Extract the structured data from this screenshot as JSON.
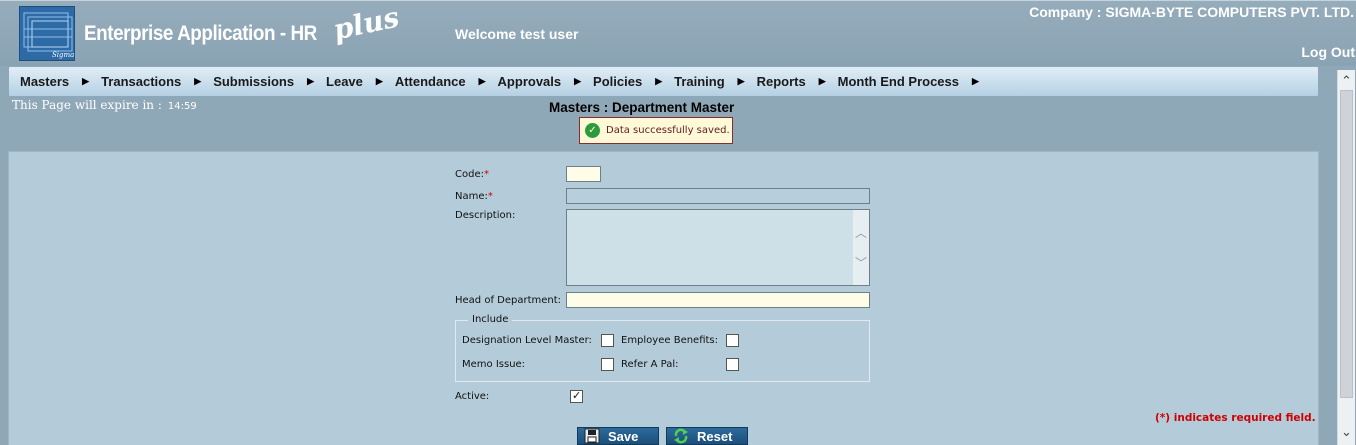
{
  "header": {
    "logo_caption": "Sigma Byte",
    "app_title": "Enterprise Application - HR",
    "app_suffix": "plus",
    "welcome": "Welcome test user",
    "company": "Company : SIGMA-BYTE COMPUTERS PVT. LTD.",
    "logout": "Log Out"
  },
  "nav": {
    "items": [
      "Masters",
      "Transactions",
      "Submissions",
      "Leave",
      "Attendance",
      "Approvals",
      "Policies",
      "Training",
      "Reports",
      "Month End Process"
    ]
  },
  "session": {
    "expire_label": "This Page will expire in :",
    "expire_time": "14:59"
  },
  "page": {
    "title": "Masters : Department Master",
    "message": "Data successfully saved."
  },
  "form": {
    "code_label": "Code:",
    "code_value": "",
    "name_label": "Name:",
    "name_value": "",
    "description_label": "Description:",
    "description_value": "",
    "hod_label": "Head of Department:",
    "hod_value": "",
    "include_legend": "Include",
    "designation_label": "Designation Level Master:",
    "designation_checked": false,
    "benefits_label": "Employee Benefits:",
    "benefits_checked": false,
    "memo_label": "Memo Issue:",
    "memo_checked": false,
    "refer_label": "Refer A Pal:",
    "refer_checked": false,
    "active_label": "Active:",
    "active_checked": true,
    "required_note": "(*) indicates required field."
  },
  "buttons": {
    "save": "Save",
    "reset": "Reset"
  },
  "colors": {
    "background": "#8fa8b8",
    "panel": "#b4ccd9",
    "required": "#d00000",
    "button": "#1d4f7a",
    "success": "#2e9b3a"
  }
}
